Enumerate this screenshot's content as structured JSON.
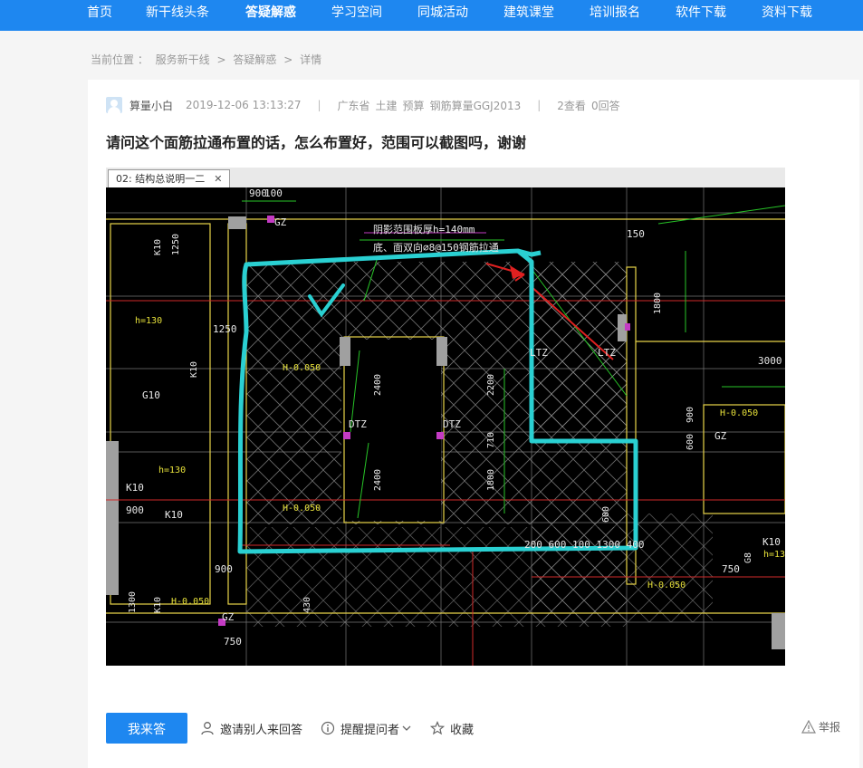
{
  "nav": {
    "items": [
      {
        "label": "首页"
      },
      {
        "label": "新干线头条"
      },
      {
        "label": "答疑解惑"
      },
      {
        "label": "学习空间"
      },
      {
        "label": "同城活动"
      },
      {
        "label": "建筑课堂"
      },
      {
        "label": "培训报名"
      },
      {
        "label": "软件下载"
      },
      {
        "label": "资料下载"
      }
    ],
    "active": "答疑解惑"
  },
  "breadcrumb": {
    "prefix": "当前位置 ：",
    "items": [
      "服务新干线",
      ">",
      "答疑解惑",
      ">",
      "详情"
    ]
  },
  "question": {
    "user": "算量小白",
    "time": "2019-12-06 13:13:27",
    "region": "广东省",
    "tags": [
      "土建",
      "预算",
      "钢筋算量GGJ2013"
    ],
    "views": "2查看",
    "answers": "0回答",
    "title": "请问这个面筋拉通布置的话，怎么布置好，范围可以截图吗，谢谢"
  },
  "image": {
    "tab_label": "02: 结构总说明一二",
    "tab_close": "✕",
    "labels": {
      "gz": "GZ",
      "annot1": "阴影范围板厚h=140mm",
      "annot2": "底、面双向⌀8@150钢筋拉通",
      "k10": "K10",
      "d1250": "1250",
      "h130": "h=130",
      "h0050": "H-0.050",
      "g10": "G10",
      "d900": "900",
      "d100": "100",
      "d2400": "2400",
      "dtz": "DTZ",
      "ltz": "LTZ",
      "d2200": "2200",
      "d1800": "1800",
      "d3000": "3000",
      "d750": "750",
      "d430": "430",
      "d600": "600",
      "d1300": "1300",
      "dims_bottom": "200 600 100     1300      400",
      "d8": "G8",
      "d150": "150",
      "d710": "710"
    }
  },
  "actions": {
    "answer_button": "我来答",
    "invite": "邀请别人来回答",
    "remind": "提醒提问者",
    "favorite": "收藏",
    "report": "举报"
  },
  "colors": {
    "brand": "#1e87f0"
  }
}
